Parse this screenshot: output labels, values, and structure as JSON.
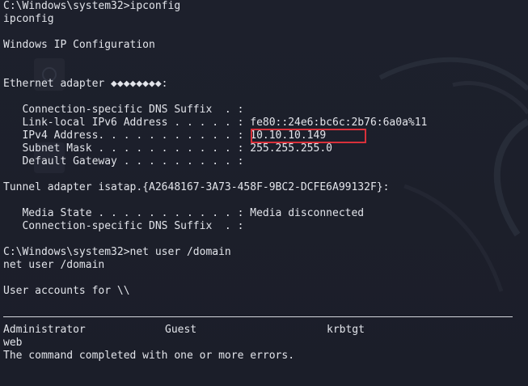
{
  "terminal": {
    "lines": [
      "C:\\Windows\\system32>ipconfig",
      "ipconfig",
      "",
      "Windows IP Configuration",
      "",
      "",
      "Ethernet adapter ◆◆◆◆◆◆◆◆:",
      "",
      "   Connection-specific DNS Suffix  . :",
      "   Link-local IPv6 Address . . . . . : fe80::24e6:bc6c:2b76:6a0a%11",
      "   IPv4 Address. . . . . . . . . . . : 10.10.10.149",
      "   Subnet Mask . . . . . . . . . . . : 255.255.255.0",
      "   Default Gateway . . . . . . . . . :",
      "",
      "Tunnel adapter isatap.{A2648167-3A73-458F-9BC2-DCFE6A99132F}:",
      "",
      "   Media State . . . . . . . . . . . : Media disconnected",
      "   Connection-specific DNS Suffix  . :",
      "",
      "C:\\Windows\\system32>net user /domain",
      "net user /domain",
      "",
      "User accounts for \\\\"
    ],
    "accounts": [
      "Administrator",
      "Guest",
      "krbtgt"
    ],
    "after_lines": [
      "web",
      "The command completed with one or more errors."
    ]
  },
  "colors": {
    "background": "#1c1f2b",
    "text": "#e2e4ea",
    "highlight": "#d9303a"
  }
}
